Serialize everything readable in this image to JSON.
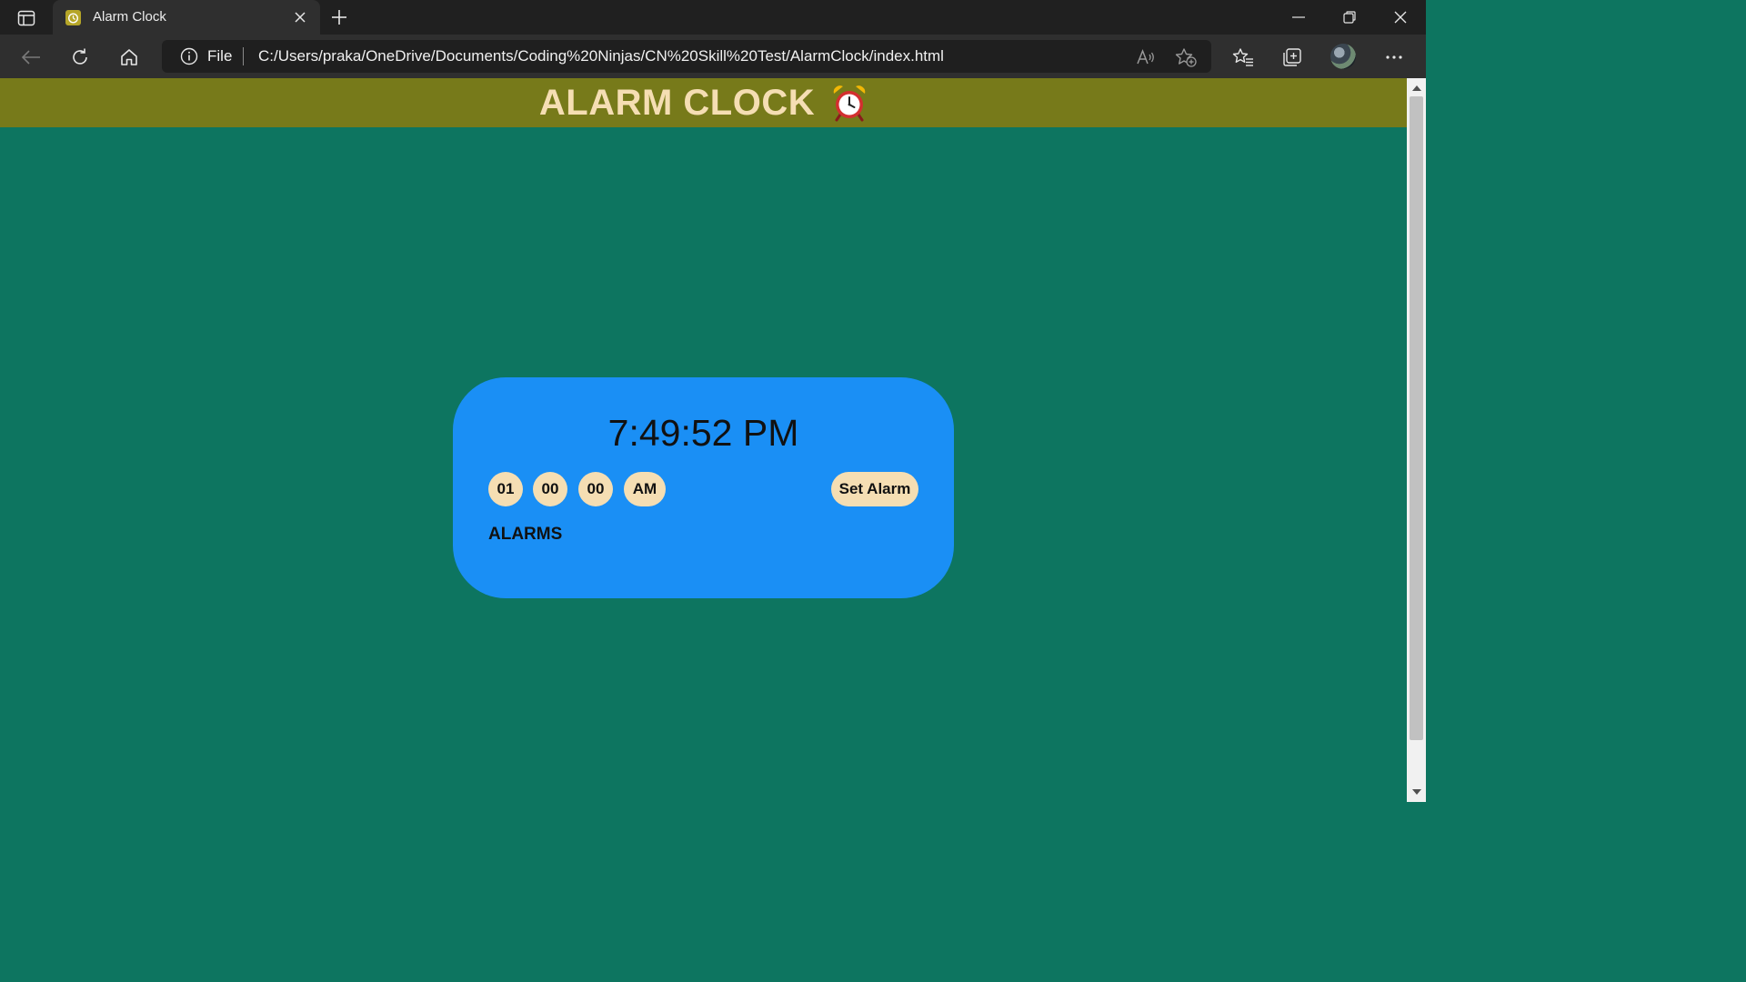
{
  "browser": {
    "tab": {
      "title": "Alarm Clock",
      "favicon": "alarm-clock-favicon"
    },
    "address_bar": {
      "scheme_label": "File",
      "url": "C:/Users/praka/OneDrive/Documents/Coding%20Ninjas/CN%20Skill%20Test/AlarmClock/index.html"
    },
    "icons": [
      "tab-actions-icon",
      "close-icon",
      "new-tab-icon",
      "minimize-icon",
      "restore-icon",
      "close-window-icon",
      "back-icon",
      "refresh-icon",
      "home-icon",
      "info-icon",
      "read-aloud-icon",
      "add-favorite-icon",
      "favorites-icon",
      "collections-icon",
      "avatar",
      "more-icon"
    ]
  },
  "page": {
    "header": {
      "title": "ALARM CLOCK",
      "title_icon": "alarm-clock-emoji"
    },
    "clock": {
      "current_time": "7:49:52 PM"
    },
    "alarm_input": {
      "hour": "01",
      "minute": "00",
      "second": "00",
      "period": "AM",
      "set_button_label": "Set Alarm"
    },
    "alarms_heading": "ALARMS",
    "alarms": []
  },
  "colors": {
    "page_background": "#0d7560",
    "header_background": "#777a1a",
    "header_text": "#f5deb3",
    "card_background": "#1a8ff5",
    "pill_background": "#f5deb3"
  }
}
